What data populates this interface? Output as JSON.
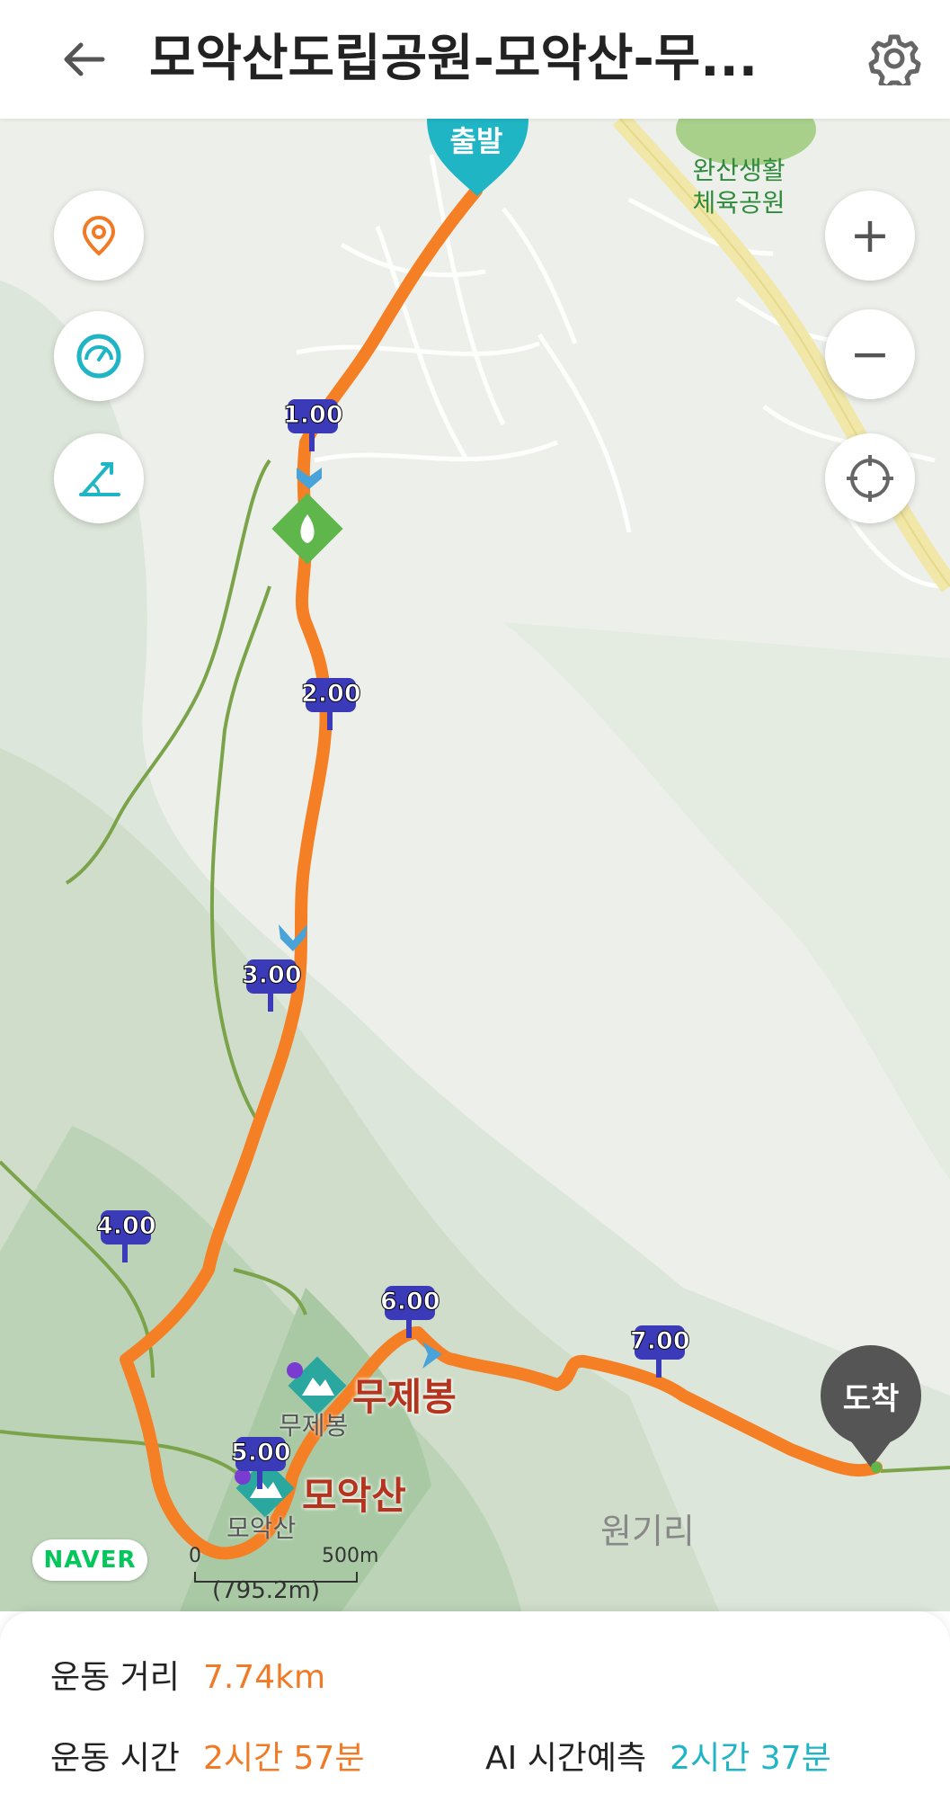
{
  "header": {
    "title": "모악산도립공원-모악산-무...",
    "back_icon": "back-arrow-icon",
    "settings_icon": "gear-icon"
  },
  "map": {
    "start_marker": "출발",
    "end_marker": "도착",
    "labels": {
      "park_line1": "완산생활",
      "park_line2": "체육공원",
      "peak1": "무제봉",
      "peak1_small": "무제봉",
      "peak2": "모악산",
      "peak2_small": "모악산",
      "village": "원기리"
    },
    "km_markers": [
      "1.00",
      "2.00",
      "3.00",
      "4.00",
      "5.00",
      "6.00",
      "7.00"
    ],
    "provider": "NAVER",
    "scale": {
      "left": "0",
      "right": "500m",
      "measure": "(795.2m)"
    },
    "controls": {
      "location_pin_icon": "location-pin-icon",
      "speed_icon": "speedometer-icon",
      "elevation_icon": "elevation-slope-icon",
      "zoom_in": "+",
      "zoom_out": "−",
      "recenter_icon": "crosshair-icon"
    },
    "colors": {
      "route": "#f57f25",
      "trail": "#7aa34a",
      "accent": "#1fb5c4",
      "km_marker": "#3b3ab8"
    }
  },
  "stats": {
    "distance_label": "운동 거리",
    "distance_value": "7.74km",
    "time_label": "운동 시간",
    "time_value": "2시간 57분",
    "ai_label": "AI 시간예측",
    "ai_value": "2시간 37분"
  }
}
